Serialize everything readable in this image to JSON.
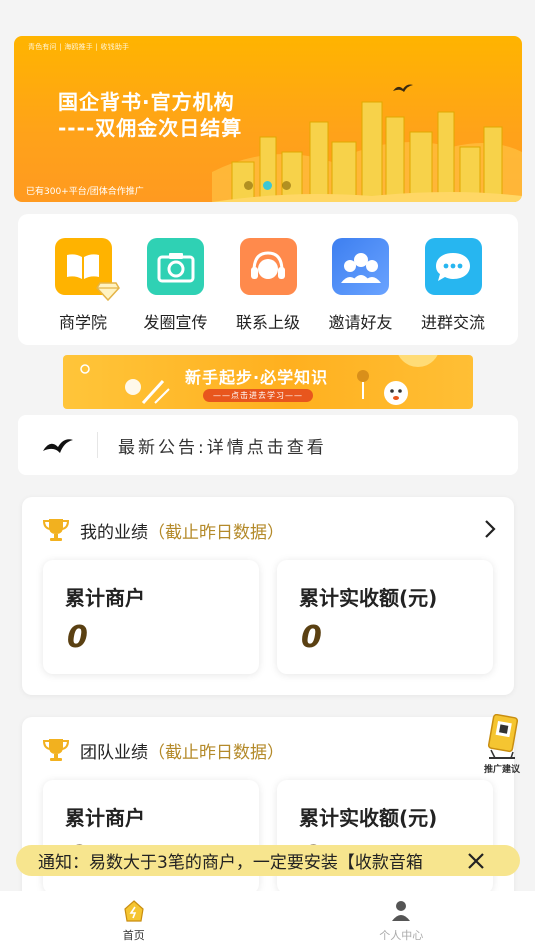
{
  "banner": {
    "tags": "青色有问 | 海鸥推手 | 收钱助手",
    "headline1": "国企背书·官方机构",
    "headline2": "----双佣金次日结算",
    "footer": "已有300+平台/团体合作推广",
    "slides": 3,
    "active_slide": 2
  },
  "menu": {
    "items": [
      {
        "label": "商学院",
        "icon": "book-icon",
        "color": "#ffb300"
      },
      {
        "label": "发圈宣传",
        "icon": "camera-icon",
        "color": "#2fd1b4"
      },
      {
        "label": "联系上级",
        "icon": "headset-icon",
        "color": "#ff8a4c"
      },
      {
        "label": "邀请好友",
        "icon": "users-icon",
        "color": "#4c8cf5"
      },
      {
        "label": "进群交流",
        "icon": "chat-icon",
        "color": "#27b6f0"
      }
    ]
  },
  "learn_banner": {
    "title": "新手起步·必学知识",
    "subtitle": "——点击进去学习——"
  },
  "notice": {
    "text": "最新公告:详情点击查看"
  },
  "my_performance": {
    "title": "我的业绩",
    "note": "（截止昨日数据）",
    "stats": [
      {
        "label": "累计商户",
        "value": "0"
      },
      {
        "label": "累计实收额(元)",
        "value": "0"
      }
    ]
  },
  "team_performance": {
    "title": "团队业绩",
    "note": "（截止昨日数据）",
    "stats": [
      {
        "label": "累计商户",
        "value": "0"
      },
      {
        "label": "累计实收额(元)",
        "value": "0"
      }
    ]
  },
  "suggest": {
    "label": "推广建议"
  },
  "marquee": {
    "text": "通知：易数大于3笔的商户，一定要安装【收款音箱"
  },
  "tabbar": {
    "tabs": [
      {
        "label": "首页",
        "active": true
      },
      {
        "label": "个人中心",
        "active": false
      }
    ]
  },
  "colors": {
    "accent": "#ffb400",
    "note": "#b48a2a",
    "value": "#5a4012"
  }
}
